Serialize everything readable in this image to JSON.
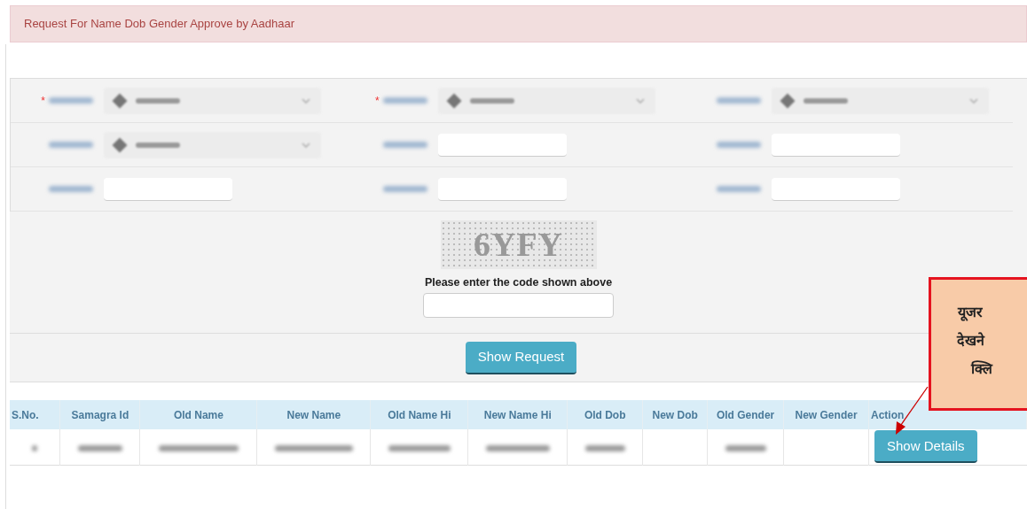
{
  "header": {
    "title": "Request For Name Dob Gender Approve by Aadhaar"
  },
  "form": {
    "fields": [
      {
        "kind": "select",
        "required_mark": "*"
      },
      {
        "kind": "select",
        "required_mark": "*"
      },
      {
        "kind": "select"
      },
      {
        "kind": "select"
      },
      {
        "kind": "input"
      },
      {
        "kind": "input"
      },
      {
        "kind": "input"
      },
      {
        "kind": "input"
      },
      {
        "kind": "input"
      }
    ]
  },
  "captcha": {
    "code": "6YFY",
    "prompt": "Please enter the code shown above"
  },
  "show_request_button": "Show Request",
  "table": {
    "columns": [
      "S.No.",
      "Samagra Id",
      "Old Name",
      "New Name",
      "Old Name Hi",
      "New Name Hi",
      "Old Dob",
      "New Dob",
      "Old Gender",
      "New Gender",
      "Action"
    ],
    "rows": [
      {
        "cells": [
          {
            "kind": "blurred"
          },
          {
            "kind": "blurred"
          },
          {
            "kind": "blurred"
          },
          {
            "kind": "blurred"
          },
          {
            "kind": "blurred"
          },
          {
            "kind": "blurred"
          },
          {
            "kind": "blurred"
          },
          {
            "kind": "empty"
          },
          {
            "kind": "blurred"
          },
          {
            "kind": "empty"
          }
        ],
        "action": "Show Details"
      }
    ]
  },
  "callout": {
    "lines": [
      "यूजर",
      "देखने",
      "क्लि"
    ]
  }
}
